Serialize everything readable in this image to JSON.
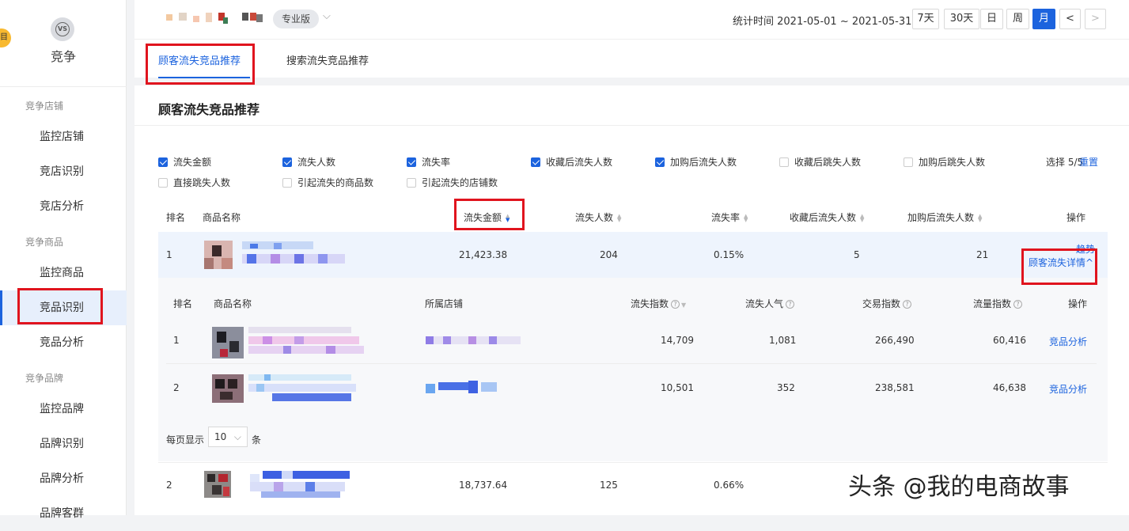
{
  "sidebar": {
    "badge": "目",
    "icon_text": "VS",
    "title": "竞争",
    "groups": [
      {
        "label": "竞争店铺",
        "items": [
          "监控店铺",
          "竞店识别",
          "竞店分析"
        ]
      },
      {
        "label": "竞争商品",
        "items": [
          "监控商品",
          "竞品识别",
          "竞品分析"
        ]
      },
      {
        "label": "竞争品牌",
        "items": [
          "监控品牌",
          "品牌识别",
          "品牌分析",
          "品牌客群"
        ]
      }
    ],
    "active_item": "竞品识别",
    "accent": "#1c63de"
  },
  "header": {
    "edition": "专业版",
    "stat_time": "统计时间 2021-05-01 ~ 2021-05-31",
    "ranges": [
      "7天",
      "30天",
      "日",
      "周",
      "月"
    ],
    "active_range": "月",
    "prev": "<",
    "next": ">"
  },
  "tabs": [
    "顾客流失竞品推荐",
    "搜索流失竞品推荐"
  ],
  "section_title": "顾客流失竞品推荐",
  "metrics": [
    {
      "label": "流失金额",
      "checked": true
    },
    {
      "label": "流失人数",
      "checked": true
    },
    {
      "label": "流失率",
      "checked": true
    },
    {
      "label": "收藏后流失人数",
      "checked": true
    },
    {
      "label": "加购后流失人数",
      "checked": true
    },
    {
      "label": "收藏后跳失人数",
      "checked": false
    },
    {
      "label": "加购后跳失人数",
      "checked": false
    },
    {
      "label": "直接跳失人数",
      "checked": false
    },
    {
      "label": "引起流失的商品数",
      "checked": false
    },
    {
      "label": "引起流失的店铺数",
      "checked": false
    }
  ],
  "selection": {
    "count": "选择 5/5",
    "reset": "重置"
  },
  "table": {
    "headers": [
      "排名",
      "商品名称",
      "流失金额",
      "流失人数",
      "流失率",
      "收藏后流失人数",
      "加购后流失人数",
      "操作"
    ],
    "rows": [
      {
        "rank": "1",
        "amount": "21,423.38",
        "people": "204",
        "rate": "0.15%",
        "fav": "5",
        "cart": "21",
        "action1": "趋势",
        "action2": "顾客流失详情^"
      },
      {
        "rank": "2",
        "amount": "18,737.64",
        "people": "125",
        "rate": "0.66%"
      }
    ]
  },
  "sub_table": {
    "headers": [
      "排名",
      "商品名称",
      "所属店铺",
      "流失指数",
      "流失人气",
      "交易指数",
      "流量指数",
      "操作"
    ],
    "rows": [
      {
        "rank": "1",
        "index": "14,709",
        "popularity": "1,081",
        "trade": "266,490",
        "flow": "60,416",
        "action": "竞品分析"
      },
      {
        "rank": "2",
        "index": "10,501",
        "popularity": "352",
        "trade": "238,581",
        "flow": "46,638",
        "action": "竞品分析"
      }
    ],
    "page_size_label": "每页显示",
    "page_size": "10",
    "page_size_unit": "条"
  },
  "watermark": "头条 @我的电商故事"
}
